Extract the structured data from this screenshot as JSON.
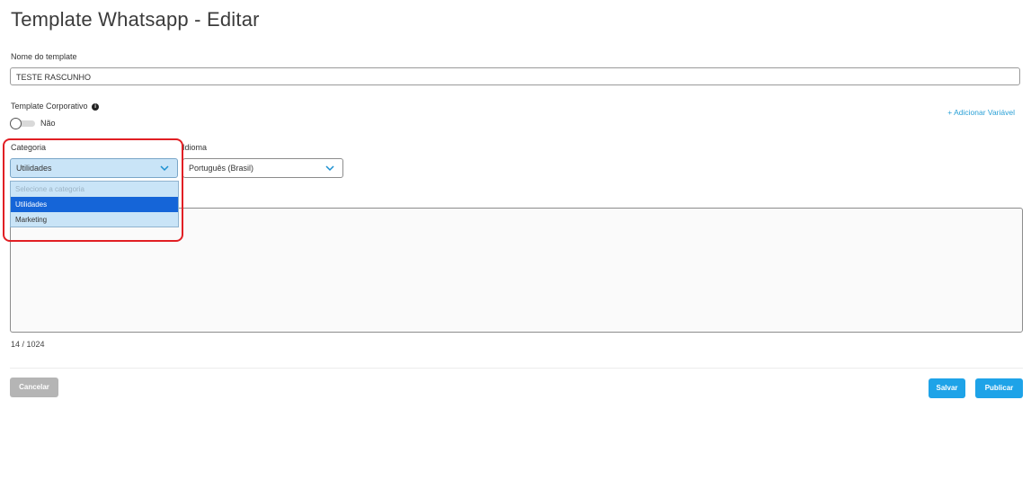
{
  "page": {
    "title": "Template Whatsapp - Editar"
  },
  "form": {
    "name_label": "Nome do template",
    "name_value": "TESTE RASCUNHO",
    "corporate_label": "Template Corporativo",
    "info_symbol": "i",
    "corporate_toggle": {
      "state": "off",
      "text": "Não"
    },
    "add_variable": "+ Adicionar Variável",
    "category_label": "Categoria",
    "category_value": "Utilidades",
    "category_options": [
      {
        "label": "Selecione a categoria",
        "placeholder": true
      },
      {
        "label": "Utilidades",
        "selected": true
      },
      {
        "label": "Marketing"
      }
    ],
    "language_label": "Idioma",
    "language_value": "Português (Brasil)",
    "message_value": "",
    "char_counter": "14 / 1024"
  },
  "actions": {
    "cancel": "Cancelar",
    "save": "Salvar",
    "publish": "Publicar"
  },
  "colors": {
    "accent": "#1ea3e8",
    "link": "#2aa0d6",
    "dropdown_bg": "#c9e4f7",
    "dropdown_selected": "#1565d8",
    "highlight": "#e11f24",
    "cancel_bg": "#b5b5b5"
  },
  "icons": {
    "info": "info-circle-icon",
    "chevron": "chevron-down-icon",
    "resize": "resize-handle-icon"
  }
}
